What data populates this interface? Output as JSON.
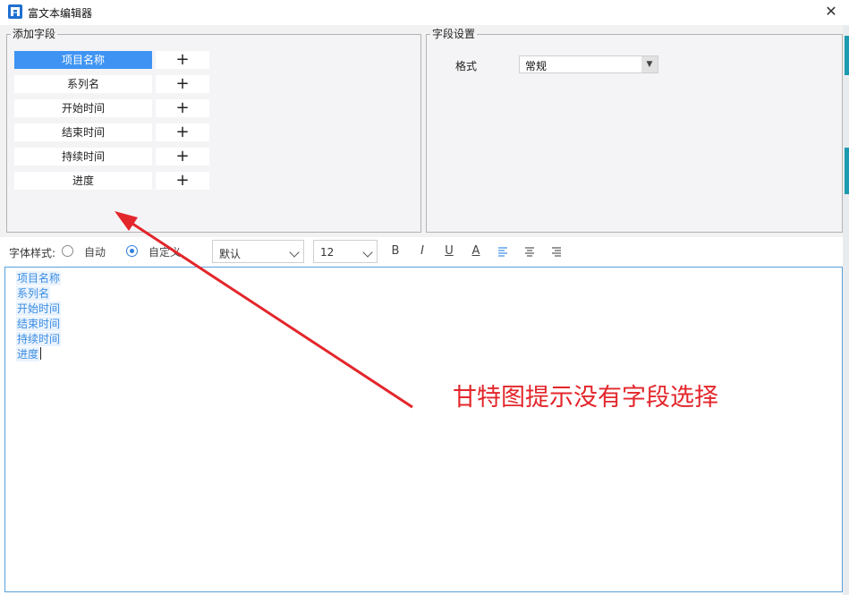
{
  "window": {
    "title": "富文本编辑器",
    "app_icon": "app-logo-icon",
    "close_symbol": "✕"
  },
  "field_group": {
    "legend": "添加字段",
    "add_symbol": "+",
    "items": [
      {
        "label": "项目名称",
        "selected": true
      },
      {
        "label": "系列名",
        "selected": false
      },
      {
        "label": "开始时间",
        "selected": false
      },
      {
        "label": "结束时间",
        "selected": false
      },
      {
        "label": "持续时间",
        "selected": false
      },
      {
        "label": "进度",
        "selected": false
      }
    ]
  },
  "settings_group": {
    "legend": "字段设置",
    "format_label": "格式",
    "format_value": "常规"
  },
  "toolbar": {
    "font_style_label": "字体样式:",
    "radio_auto": "自动",
    "radio_custom": "自定义",
    "font_family": "默认",
    "font_size": "12",
    "bold": "B",
    "italic": "I",
    "underline": "U",
    "font_color": "A"
  },
  "editor": {
    "lines": [
      "项目名称",
      "系列名",
      "开始时间",
      "结束时间",
      "持续时间",
      "进度"
    ]
  },
  "annotation": {
    "text": "甘特图提示没有字段选择",
    "color": "#e3262b"
  },
  "colors": {
    "selected_bg": "#3f94f3",
    "tag_text": "#3b8de4",
    "accent": "#2f7fe0"
  }
}
